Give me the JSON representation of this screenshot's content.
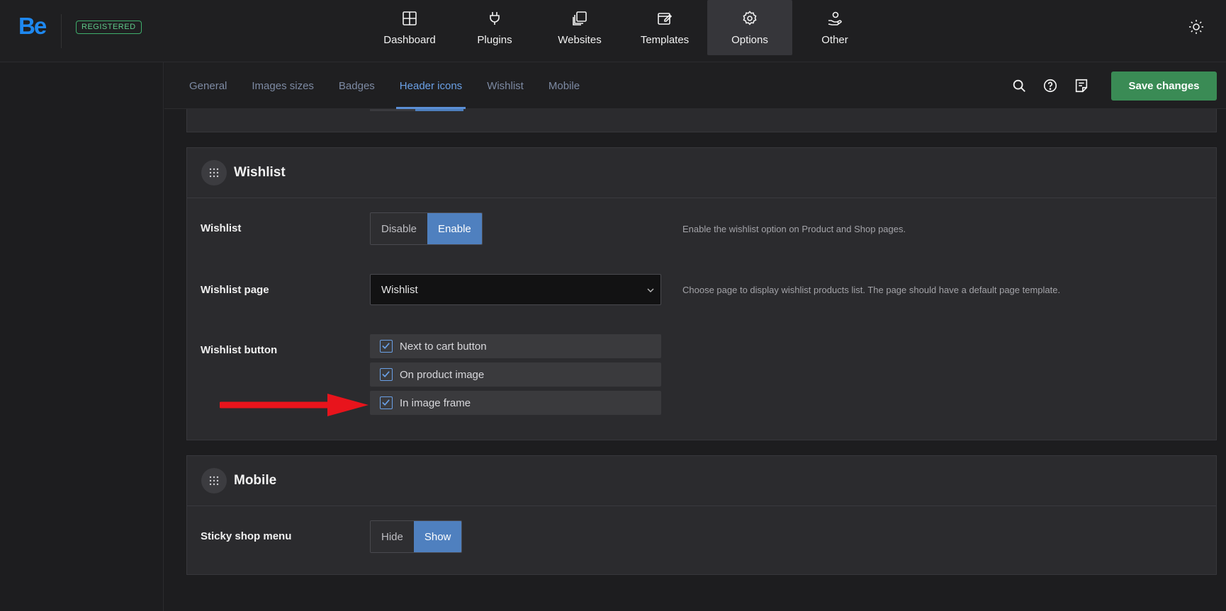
{
  "brand": {
    "logo_text": "Be",
    "badge": "REGISTERED",
    "accent": "#1e88f0"
  },
  "nav": [
    {
      "label": "Dashboard",
      "icon": "dashboard-icon",
      "active": false
    },
    {
      "label": "Plugins",
      "icon": "plug-icon",
      "active": false
    },
    {
      "label": "Websites",
      "icon": "websites-icon",
      "active": false
    },
    {
      "label": "Templates",
      "icon": "templates-icon",
      "active": false
    },
    {
      "label": "Options",
      "icon": "gear-icon",
      "active": true
    },
    {
      "label": "Other",
      "icon": "hand-user-icon",
      "active": false
    }
  ],
  "subtabs": [
    {
      "label": "General",
      "active": false
    },
    {
      "label": "Images sizes",
      "active": false
    },
    {
      "label": "Badges",
      "active": false
    },
    {
      "label": "Header icons",
      "active": true
    },
    {
      "label": "Wishlist",
      "active": false
    },
    {
      "label": "Mobile",
      "active": false
    }
  ],
  "toolbar": {
    "save_label": "Save changes",
    "save_color": "#3a8b55"
  },
  "wishlist_panel": {
    "title": "Wishlist",
    "rows": {
      "wishlist": {
        "label": "Wishlist",
        "options": [
          "Disable",
          "Enable"
        ],
        "selected": "Enable",
        "description": "Enable the wishlist option on Product and Shop pages."
      },
      "page": {
        "label": "Wishlist page",
        "value": "Wishlist",
        "description": "Choose page to display wishlist products list. The page should have a default page template."
      },
      "button": {
        "label": "Wishlist button",
        "checkboxes": [
          {
            "label": "Next to cart button",
            "checked": true
          },
          {
            "label": "On product image",
            "checked": true
          },
          {
            "label": "In image frame",
            "checked": true
          }
        ]
      }
    }
  },
  "mobile_panel": {
    "title": "Mobile",
    "rows": {
      "sticky": {
        "label": "Sticky shop menu",
        "options": [
          "Hide",
          "Show"
        ],
        "selected": "Show"
      }
    }
  },
  "annotation": {
    "arrow_color": "#e8141c"
  }
}
